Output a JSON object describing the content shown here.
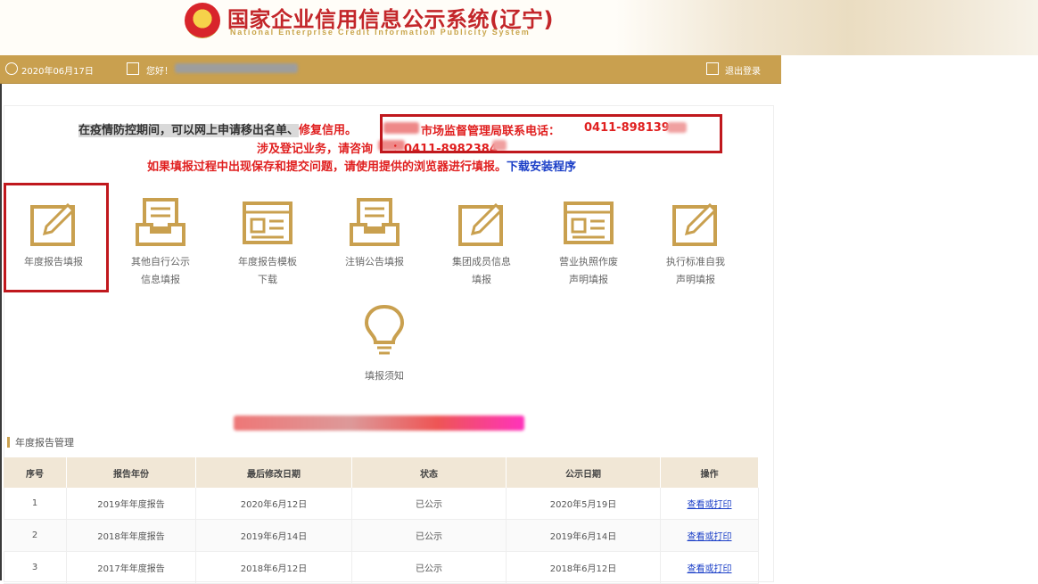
{
  "header": {
    "title_cn": "国家企业信用信息公示系统(辽宁)",
    "title_en": "National Enterprise Credit Information Publicity System"
  },
  "topbar": {
    "date": "2020年06月17日",
    "account_prefix": "您好！",
    "logout": "退出登录"
  },
  "notice": {
    "line1_highlight": "在疫情防控期间，可以网上申请移出名单、",
    "line1_red": "修复信用。",
    "line1_box": "市场监督管理局联系电话：",
    "line1_phone": "0411-898139",
    "line2": "涉及登记业务，请咨询",
    "line2_phone": "：0411-8982384",
    "line3": "如果填报过程中出现保存和提交问题，请使用提供的浏览器进行填报。",
    "download_link": "下载安装程序"
  },
  "tiles": [
    {
      "label1": "年度报告填报",
      "label2": ""
    },
    {
      "label1": "其他自行公示",
      "label2": "信息填报"
    },
    {
      "label1": "年度报告模板",
      "label2": "下载"
    },
    {
      "label1": "注销公告填报",
      "label2": ""
    },
    {
      "label1": "集团成员信息",
      "label2": "填报"
    },
    {
      "label1": "营业执照作废",
      "label2": "声明填报"
    },
    {
      "label1": "执行标准自我",
      "label2": "声明填报"
    },
    {
      "label1": "填报须知",
      "label2": ""
    }
  ],
  "section": {
    "title": "年度报告管理"
  },
  "table": {
    "headers": [
      "序号",
      "报告年份",
      "最后修改日期",
      "状态",
      "公示日期",
      "操作"
    ],
    "rows": [
      [
        "1",
        "2019年年度报告",
        "2020年6月12日",
        "已公示",
        "2020年5月19日",
        "查看或打印"
      ],
      [
        "2",
        "2018年年度报告",
        "2019年6月14日",
        "已公示",
        "2019年6月14日",
        "查看或打印"
      ],
      [
        "3",
        "2017年年度报告",
        "2018年6月12日",
        "已公示",
        "2018年6月12日",
        "查看或打印"
      ]
    ]
  },
  "colors": {
    "gold": "#c9a04f",
    "red": "#e02020",
    "link": "#1a3ec7",
    "box": "#c0181d"
  }
}
